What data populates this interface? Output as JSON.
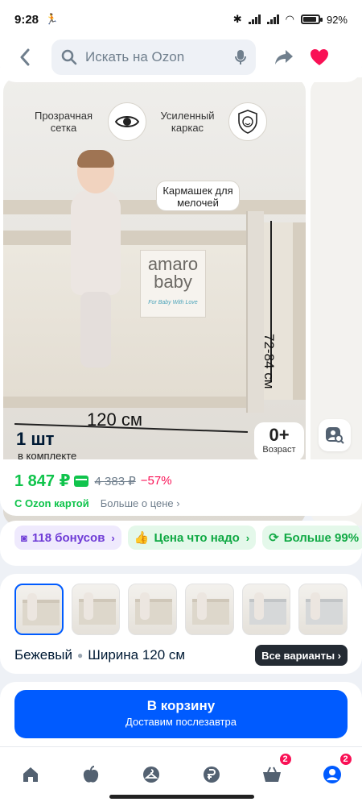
{
  "status_bar": {
    "time": "9:28",
    "battery": "92%"
  },
  "search": {
    "placeholder": "Искать на Ozon"
  },
  "product_image": {
    "feature_1": "Прозрачная сетка",
    "feature_2": "Усиленный каркас",
    "pocket_label": "Кармашек для мелочей",
    "brand_line_1": "amaro",
    "brand_line_2": "baby",
    "brand_tagline": "For Baby With Love",
    "height_dim": "72-84 см",
    "width_dim": "120 см",
    "qty": "1 шт",
    "qty_sub": "в комплекте",
    "age_value": "0+",
    "age_label": "Возраст"
  },
  "price": {
    "current": "1 847 ₽",
    "old": "4 383 ₽",
    "discount": "−57%",
    "card_label": "С Ozon картой",
    "more_label": "Больше о цене ›"
  },
  "chips": [
    {
      "label": "118 бонусов"
    },
    {
      "label": "Цена что надо"
    },
    {
      "label": "Больше 99%"
    }
  ],
  "variants": {
    "color": "Бежевый",
    "width": "Ширина 120 см",
    "all_button": "Все варианты ›"
  },
  "cart": {
    "title": "В корзину",
    "subtitle": "Доставим послезавтра"
  },
  "nav": {
    "cart_badge": "2",
    "profile_badge": "2"
  },
  "colors": {
    "accent": "#005bff",
    "green": "#10c44c",
    "pink": "#f91155"
  }
}
